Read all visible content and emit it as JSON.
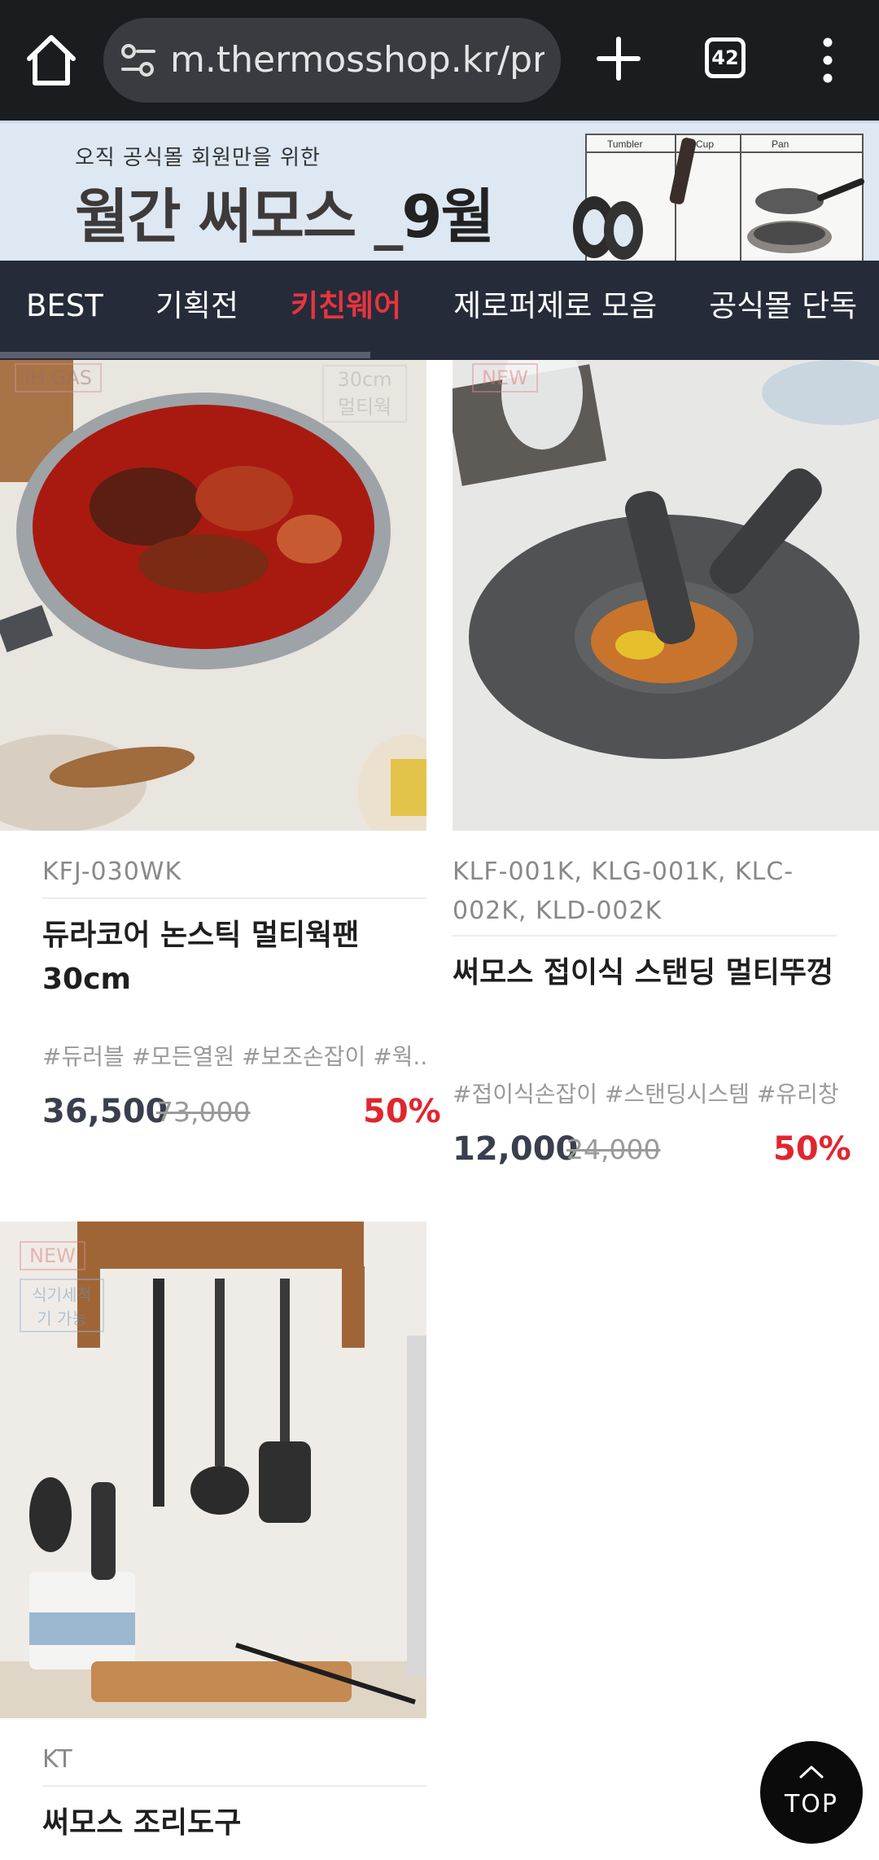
{
  "browser": {
    "url": "m.thermosshop.kr/prc",
    "tab_count": "42"
  },
  "banner": {
    "subtitle": "오직 공식몰 회원만을 위한",
    "title_main": "월간 써모스",
    "title_month": "9월",
    "labels": [
      "Tumbler",
      "Cup",
      "Pan"
    ]
  },
  "category_nav": {
    "items": [
      "BEST",
      "기획전",
      "키친웨어",
      "제로퍼제로 모음",
      "공식몰 단독"
    ],
    "active_index": 2,
    "colors": {
      "background": "#262b3a",
      "active": "#e8343f"
    }
  },
  "products": [
    {
      "badges": [
        "IH GAS",
        "30cm 멀티웍"
      ],
      "model": "KFJ-030WK",
      "name": "듀라코어 논스틱 멀티웍팬 30cm",
      "tags": "#듀러블 #모든열원 #보조손잡이 #웍...",
      "price": "36,500",
      "original_price": "73,000",
      "discount": "50%"
    },
    {
      "badges": [
        "NEW"
      ],
      "model": "KLF-001K, KLG-001K, KLC-002K, KLD-002K",
      "name": "써모스 접이식 스탠딩 멀티뚜껑",
      "tags": "#접이식손잡이 #스탠딩시스템 #유리창",
      "price": "12,000",
      "original_price": "24,000",
      "discount": "50%"
    },
    {
      "badges": [
        "NEW",
        "식기세척기 가능"
      ],
      "model": "KT",
      "name": "써모스 조리도구"
    }
  ],
  "top_button": {
    "label": "TOP"
  },
  "colors": {
    "price_discount": "#e0262f"
  }
}
